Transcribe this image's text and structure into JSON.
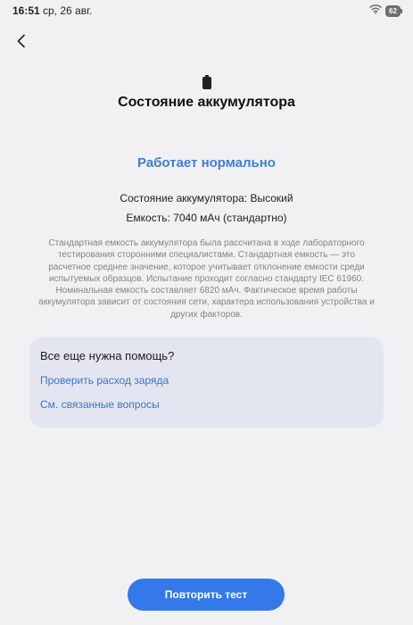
{
  "status_bar": {
    "time": "16:51",
    "date": "ср, 26 авг.",
    "battery_level": "62",
    "icons": [
      "wifi-icon",
      "battery-icon"
    ]
  },
  "header": {
    "back_icon": "back-arrow-icon",
    "hero_icon": "battery-icon",
    "title": "Состояние аккумулятора"
  },
  "status": {
    "headline": "Работает нормально",
    "health_line": "Состояние аккумулятора: Высокий",
    "capacity_line": "Емкость: 7040 мАч (стандартно)"
  },
  "description": "Стандартная емкость аккумулятора была рассчитана в ходе лабораторного тестирования сторонними специалистами. Стандартная емкость — это расчетное среднее значение, которое учитывает отклонение емкости среди испытуемых образцов. Испытание проходит согласно стандарту IEC 61960. Номинальная емкость составляет 6820 мАч. Фактическое время работы аккумулятора зависит от состояния сети, характера использования устройства и других факторов.",
  "help": {
    "title": "Все еще нужна помощь?",
    "links": [
      "Проверить расход заряда",
      "См. связанные вопросы"
    ]
  },
  "actions": {
    "retest_label": "Повторить тест"
  },
  "colors": {
    "background": "#f1f1f3",
    "accent": "#3f7fd4",
    "link": "#3a73c8",
    "button": "#3478ea",
    "card": "#e3e6f0"
  }
}
